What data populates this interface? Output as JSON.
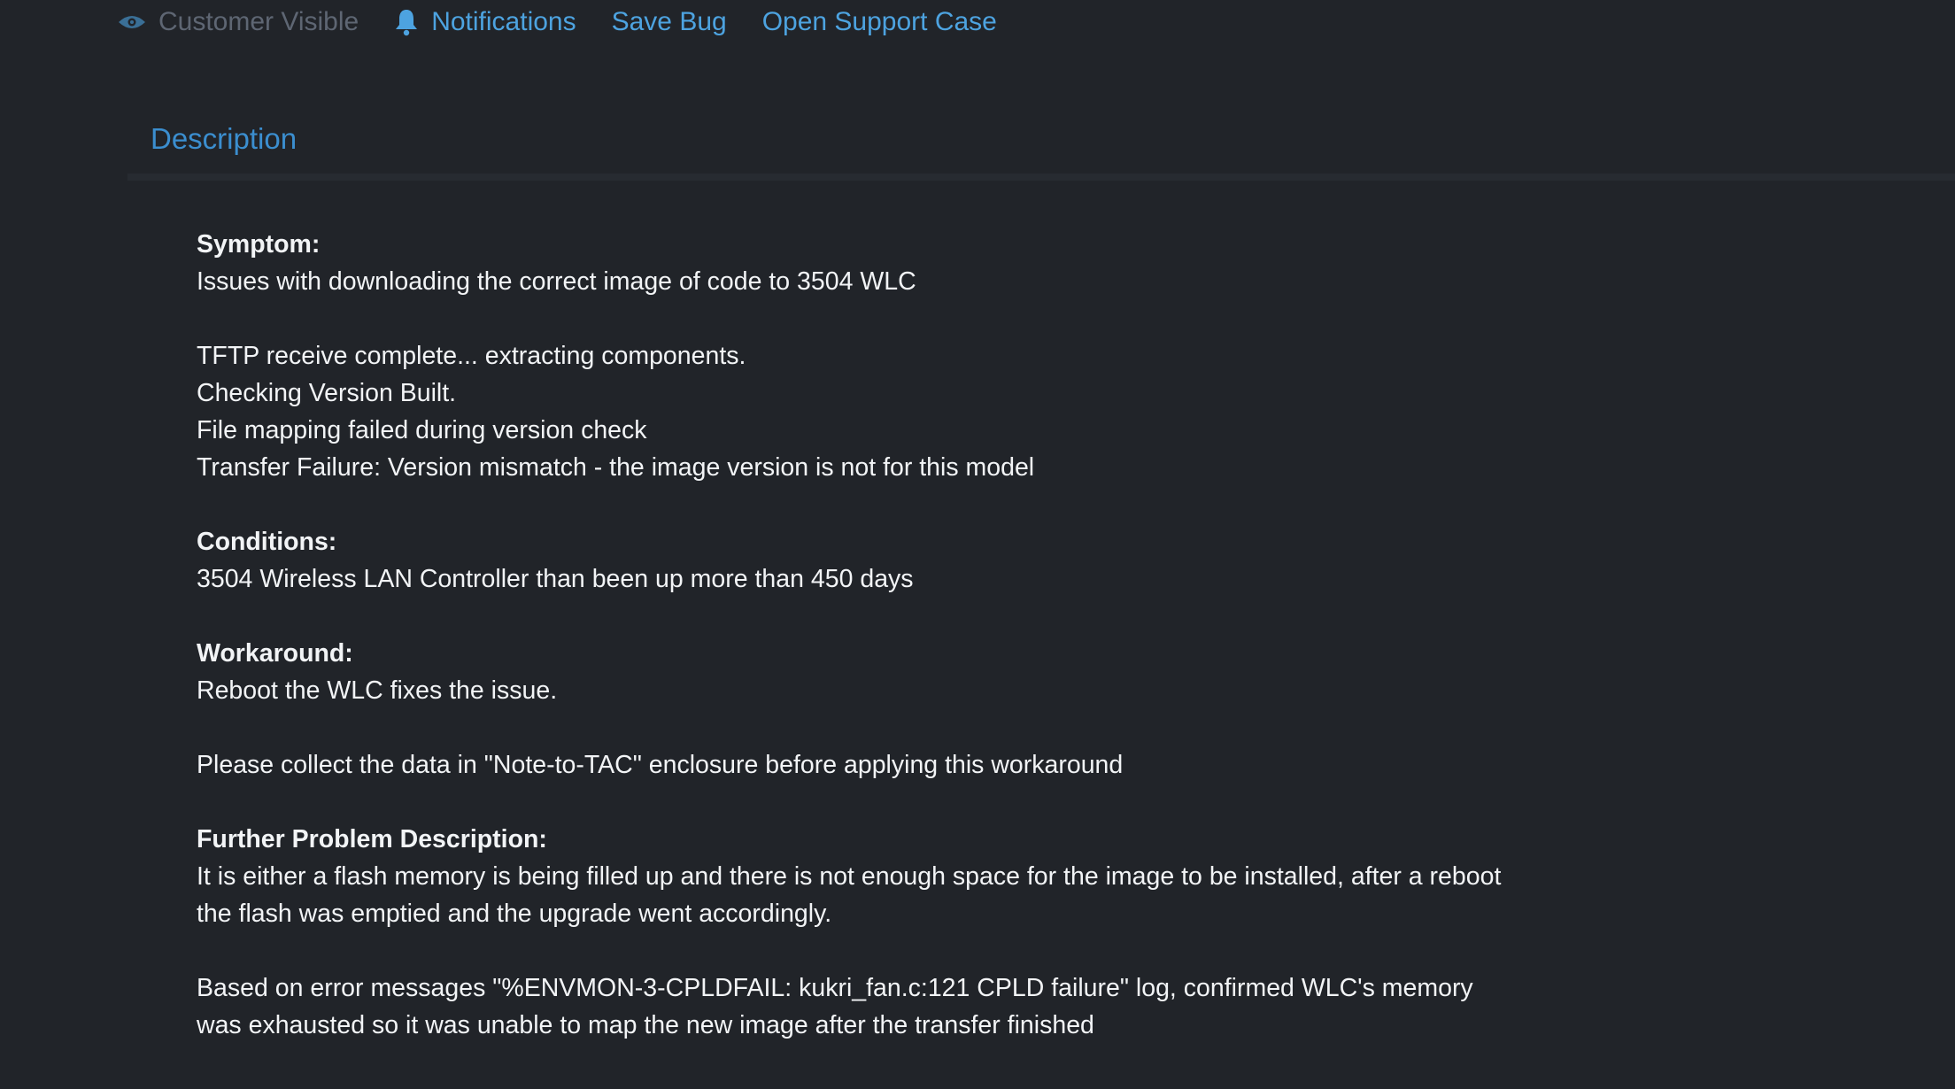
{
  "toolbar": {
    "customer_visible": {
      "label": "Customer Visible",
      "icon": "eye-icon"
    },
    "notifications": {
      "label": "Notifications",
      "icon": "bell-icon"
    },
    "save_bug": {
      "label": "Save Bug"
    },
    "open_support_case": {
      "label": "Open Support Case"
    }
  },
  "tabs": {
    "description": "Description"
  },
  "colors": {
    "background": "#212429",
    "link": "#4da3e0",
    "tab": "#3b8ecf",
    "muted": "#5e6673",
    "text": "#f2f4f6"
  },
  "description": {
    "symptom_heading": "Symptom:",
    "symptom_text": "Issues with downloading the correct image of code to 3504 WLC",
    "log_lines": [
      "TFTP receive complete... extracting components.",
      "Checking Version Built.",
      "File mapping failed during version check",
      "Transfer Failure: Version mismatch - the image version is not for this model"
    ],
    "conditions_heading": "Conditions:",
    "conditions_text": "3504 Wireless LAN Controller than been up more than 450 days",
    "workaround_heading": "Workaround:",
    "workaround_text": "Reboot the WLC fixes the issue.",
    "workaround_note": "Please collect the data in \"Note-to-TAC\" enclosure before applying this workaround",
    "further_heading": "Further Problem Description:",
    "further_text_1": "It is either a flash memory is being filled up and there is not enough space for the image to be installed, after a reboot the flash was emptied and the upgrade went accordingly.",
    "further_text_2": "Based on error messages \"%ENVMON-3-CPLDFAIL: kukri_fan.c:121 CPLD failure\" log, confirmed WLC's memory was exhausted so it was unable to map the new image after the transfer finished"
  }
}
